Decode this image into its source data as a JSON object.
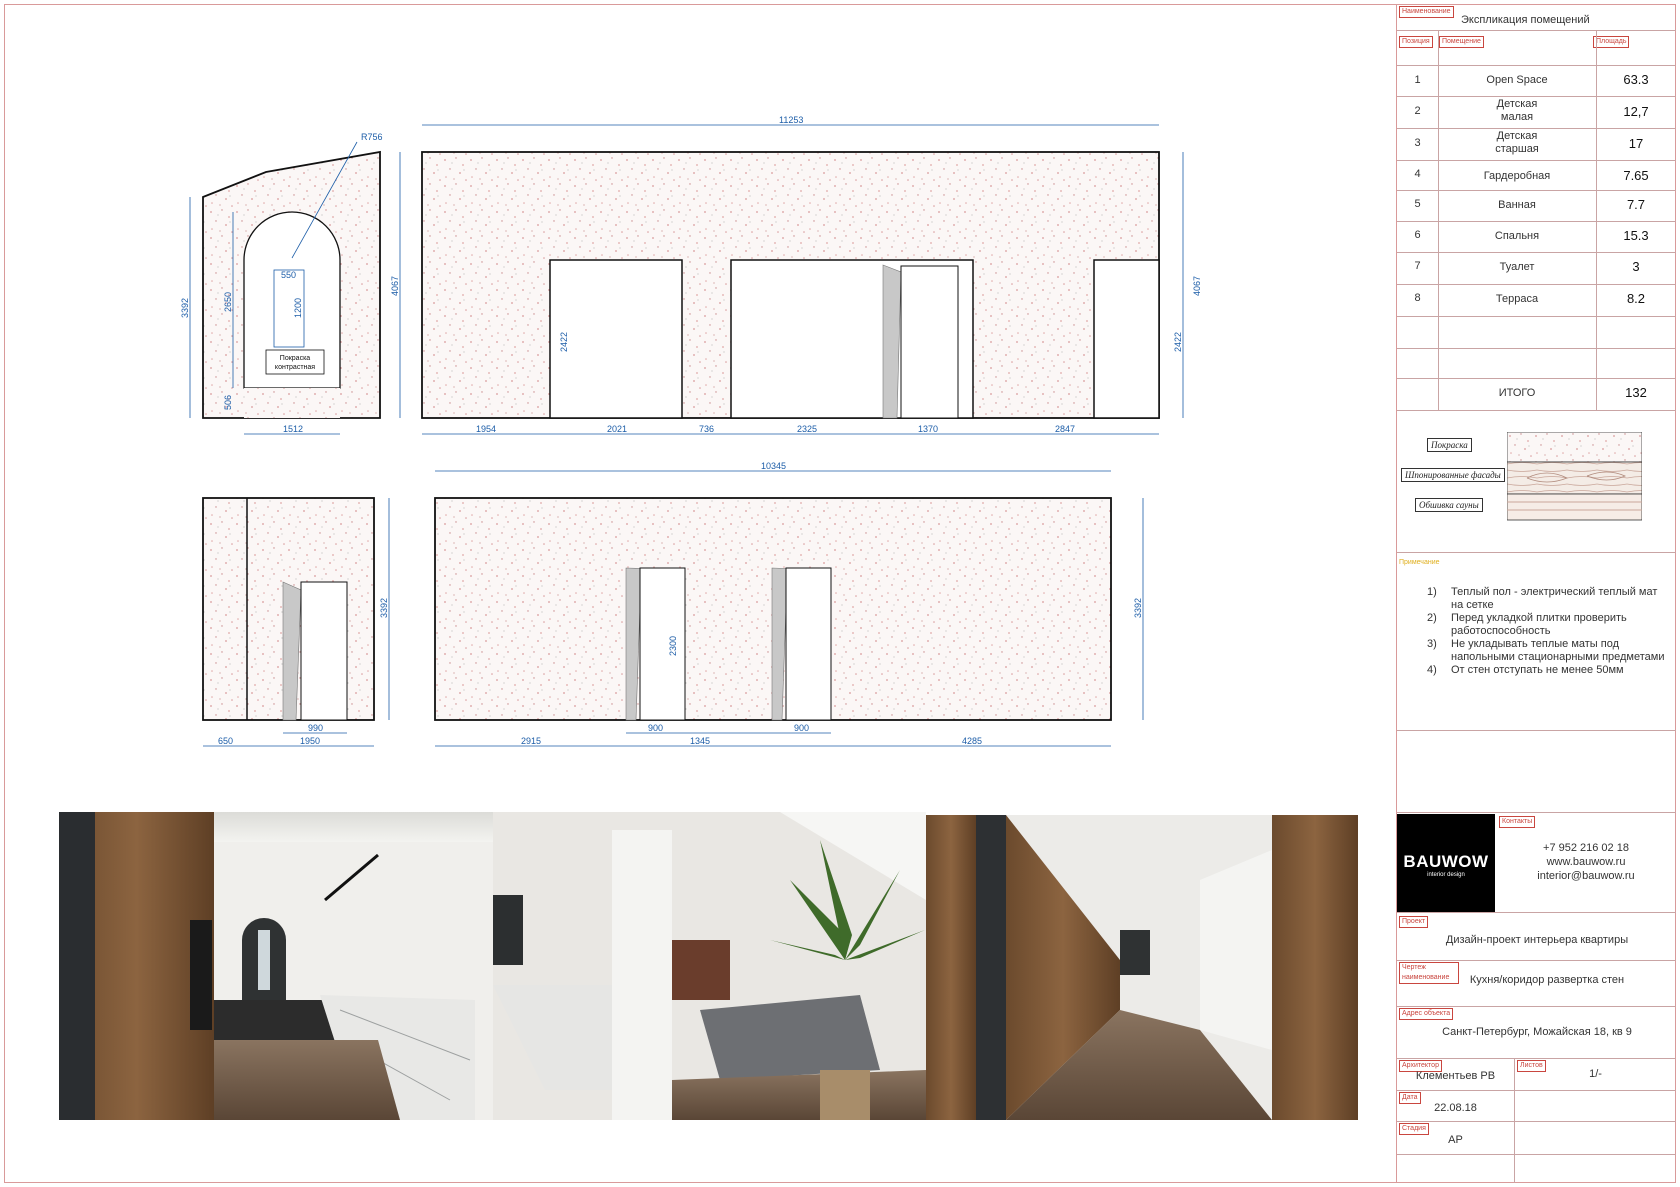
{
  "drawing": {
    "dims": {
      "radius": "R756",
      "left_wall_height": "3392",
      "arch_height": "2650",
      "window_width": "550",
      "window_height": "1200",
      "base_height": "506",
      "right_wall_height": "4067",
      "arch_width": "1512",
      "paint_label_line1": "Покраска",
      "paint_label_line2": "контрастная",
      "long_total": "11253",
      "door_height_a": "2422",
      "wall_height_right": "4067",
      "door_height_b": "2422",
      "seg": [
        "1954",
        "2021",
        "736",
        "2325",
        "1370",
        "2847"
      ],
      "b_total": "10345",
      "b_height_left": "3392",
      "b_height_right": "3392",
      "b_door_height": "2300",
      "b_door_width_small": "990",
      "b_seg_left": [
        "650",
        "1950"
      ],
      "b_seg": [
        "2915",
        "900",
        "1345",
        "900",
        "4285"
      ]
    }
  },
  "sidebar": {
    "title_tag": "Наименование",
    "title": "Экспликация помещений",
    "col_position": "Позиция",
    "col_room": "Помещение",
    "col_area": "Площадь",
    "rooms": [
      {
        "pos": "1",
        "name": "Open Space",
        "area": "63.3"
      },
      {
        "pos": "2",
        "name": "Детская\nмалая",
        "area": "12,7"
      },
      {
        "pos": "3",
        "name": "Детская\nстаршая",
        "area": "17"
      },
      {
        "pos": "4",
        "name": "Гардеробная",
        "area": "7.65"
      },
      {
        "pos": "5",
        "name": "Ванная",
        "area": "7.7"
      },
      {
        "pos": "6",
        "name": "Спальня",
        "area": "15.3"
      },
      {
        "pos": "7",
        "name": "Туалет",
        "area": "3"
      },
      {
        "pos": "8",
        "name": "Терраса",
        "area": "8.2"
      }
    ],
    "total_label": "ИТОГО",
    "total_value": "132",
    "legend": [
      "Покраска",
      "Шпонированные фасады",
      "Обшивка сауны"
    ],
    "notes_tag": "Примечание",
    "notes": [
      {
        "n": "1)",
        "text": "Теплый пол - электрический теплый мат на сетке"
      },
      {
        "n": "2)",
        "text": "Перед укладкой плитки проверить работоспособность"
      },
      {
        "n": "3)",
        "text": "Не укладывать теплые маты под напольными стационарными предметами"
      },
      {
        "n": "4)",
        "text": "От стен отступать не менее 50мм"
      }
    ],
    "logo": {
      "brand": "BAUWOW",
      "sub": "interior design"
    },
    "contacts_tag": "Контакты",
    "contacts": [
      "+7 952 216 02 18",
      "www.bauwow.ru",
      "interior@bauwow.ru"
    ],
    "project_tag": "Проект",
    "project": "Дизайн-проект интерьера квартиры",
    "sheet_tag": "Чертеж наименование",
    "sheet_name": "Кухня/коридор развертка стен",
    "address_tag": "Адрес объекта",
    "address": "Санкт-Петербург, Можайская 18, кв 9",
    "architect_tag": "Архитектор",
    "architect": "Клементьев РВ",
    "list_tag": "Листов",
    "list": "1/-",
    "date_tag": "Дата",
    "date": "22.08.18",
    "stage_tag": "Стадия",
    "stage": "АР"
  }
}
